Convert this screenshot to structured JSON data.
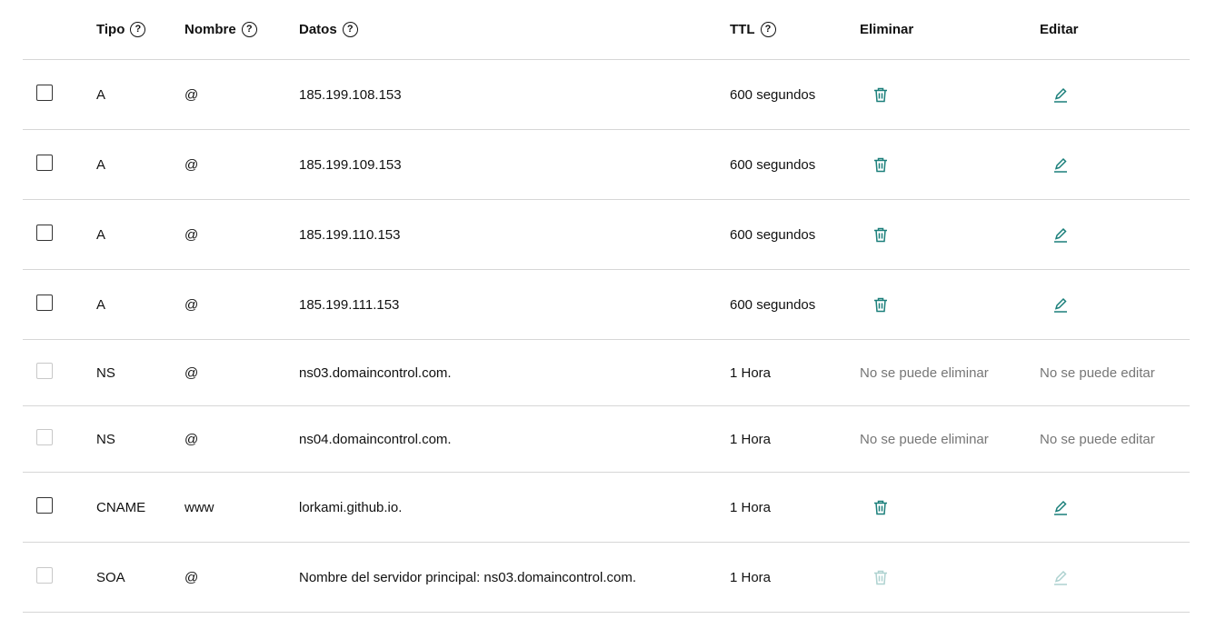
{
  "colors": {
    "accent": "#1a7f7a",
    "divider": "#d6d6d6",
    "muted_text": "#767676"
  },
  "header": {
    "type": "Tipo",
    "name": "Nombre",
    "data": "Datos",
    "ttl": "TTL",
    "delete": "Eliminar",
    "edit": "Editar",
    "help_icon": "question-circle-icon",
    "help_glyph": "?"
  },
  "records": [
    {
      "type": "A",
      "name": "@",
      "data": "185.199.108.153",
      "ttl": "600 segundos",
      "delete": "trash-icon",
      "edit": "pencil-icon"
    },
    {
      "type": "A",
      "name": "@",
      "data": "185.199.109.153",
      "ttl": "600 segundos",
      "delete": "trash-icon",
      "edit": "pencil-icon"
    },
    {
      "type": "A",
      "name": "@",
      "data": "185.199.110.153",
      "ttl": "600 segundos",
      "delete": "trash-icon",
      "edit": "pencil-icon"
    },
    {
      "type": "A",
      "name": "@",
      "data": "185.199.111.153",
      "ttl": "600 segundos",
      "delete": "trash-icon",
      "edit": "pencil-icon"
    },
    {
      "type": "NS",
      "name": "@",
      "data": "ns03.domaincontrol.com.",
      "ttl": "1 Hora",
      "delete_text": "No se puede eliminar",
      "edit_text": "No se puede editar"
    },
    {
      "type": "NS",
      "name": "@",
      "data": "ns04.domaincontrol.com.",
      "ttl": "1 Hora",
      "delete_text": "No se puede eliminar",
      "edit_text": "No se puede editar"
    },
    {
      "type": "CNAME",
      "name": "www",
      "data": "lorkami.github.io.",
      "ttl": "1 Hora",
      "delete": "trash-icon",
      "edit": "pencil-icon"
    },
    {
      "type": "SOA",
      "name": "@",
      "data": "Nombre del servidor principal: ns03.domaincontrol.com.",
      "ttl": "1 Hora",
      "delete": "trash-icon",
      "edit": "pencil-icon"
    }
  ]
}
